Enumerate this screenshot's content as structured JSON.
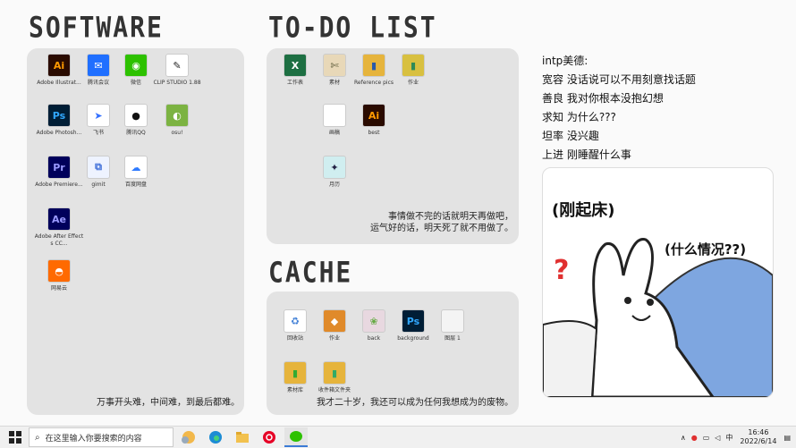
{
  "headings": {
    "software": "SOFTWARE",
    "todo": "TO-DO LIST",
    "cache": "CACHE"
  },
  "software": {
    "icons": [
      {
        "label": "Adobe Illustrat...",
        "glyph": "Ai",
        "bg": "#2a0b00",
        "fg": "#ff9a00"
      },
      {
        "label": "腾讯会议",
        "glyph": "✉",
        "bg": "#1f6fff",
        "fg": "#ffffff"
      },
      {
        "label": "微信",
        "glyph": "◉",
        "bg": "#2dc100",
        "fg": "#ffffff"
      },
      {
        "label": "CLIP STUDIO 1.88",
        "glyph": "✎",
        "bg": "#ffffff",
        "fg": "#222222"
      },
      {
        "label": "Adobe Photosh...",
        "glyph": "Ps",
        "bg": "#001e36",
        "fg": "#31a8ff"
      },
      {
        "label": "飞书",
        "glyph": "➤",
        "bg": "#ffffff",
        "fg": "#3370ff"
      },
      {
        "label": "腾讯QQ",
        "glyph": "●",
        "bg": "#ffffff",
        "fg": "#111111"
      },
      {
        "label": "osu!",
        "glyph": "◐",
        "bg": "#7cb342",
        "fg": "#ffffff"
      },
      {
        "label": "Adobe Premiere...",
        "glyph": "Pr",
        "bg": "#00005b",
        "fg": "#9999ff"
      },
      {
        "label": "gimit",
        "glyph": "⧉",
        "bg": "#eef3ff",
        "fg": "#3f6ed8"
      },
      {
        "label": "百度网盘",
        "glyph": "☁",
        "bg": "#ffffff",
        "fg": "#2f7bff"
      },
      {
        "label": "Adobe After Effects CC...",
        "glyph": "Ae",
        "bg": "#00005b",
        "fg": "#9999ff"
      },
      {
        "label": "网易云",
        "glyph": "◓",
        "bg": "#ff6a00",
        "fg": "#ffffff"
      }
    ],
    "caption": "万事开头难，中间难，到最后都难。"
  },
  "todo": {
    "icons": [
      {
        "label": "工作表",
        "glyph": "X",
        "bg": "#1d6f42",
        "fg": "#ffffff"
      },
      {
        "label": "素材",
        "glyph": "✄",
        "bg": "#e8d8b8",
        "fg": "#553"
      },
      {
        "label": "Reference pics",
        "glyph": "▮",
        "bg": "#e6b43c",
        "fg": "#2a5aa8"
      },
      {
        "label": "作业",
        "glyph": "▮",
        "bg": "#d8c040",
        "fg": "#2e8b57"
      },
      {
        "label": "画稿",
        "glyph": "",
        "bg": "#ffffff",
        "fg": "#999"
      },
      {
        "label": "best",
        "glyph": "Ai",
        "bg": "#2a0b00",
        "fg": "#ff9a00"
      },
      {
        "label": "月历",
        "glyph": "✦",
        "bg": "#d0eef0",
        "fg": "#224"
      }
    ],
    "caption_line1": "事情做不完的话就明天再做吧，",
    "caption_line2": "运气好的话，明天死了就不用做了。"
  },
  "cache": {
    "icons": [
      {
        "label": "回收站",
        "glyph": "♻",
        "bg": "#ffffff",
        "fg": "#3a7bd5"
      },
      {
        "label": "作业",
        "glyph": "◆",
        "bg": "#e08a2a",
        "fg": "#fff"
      },
      {
        "label": "back",
        "glyph": "❀",
        "bg": "#e8d8e0",
        "fg": "#6a4"
      },
      {
        "label": "background",
        "glyph": "Ps",
        "bg": "#001e36",
        "fg": "#31a8ff"
      },
      {
        "label": "图层 1",
        "glyph": "",
        "bg": "#f4f4f4",
        "fg": "#999"
      },
      {
        "label": "素材库",
        "glyph": "▮",
        "bg": "#e6b43c",
        "fg": "#3a3"
      },
      {
        "label": "收件箱文件夹",
        "glyph": "▮",
        "bg": "#e6b43c",
        "fg": "#3a6"
      }
    ],
    "caption": "我才二十岁，我还可以成为任何我想成为的废物。"
  },
  "notes": {
    "title": "intp美德:",
    "lines": [
      "宽容 没话说可以不用刻意找话题",
      "善良 我对你根本没抱幻想",
      "求知 为什么???",
      "坦率 没兴趣",
      "上进 刚睡醒什么事"
    ]
  },
  "meme": {
    "bubble1": "刚起床",
    "bubble2": "什么情况??",
    "question": "?"
  },
  "taskbar": {
    "search_placeholder": "在这里输入你要搜索的内容",
    "time": "16:46",
    "date": "2022/6/14",
    "ime": "中",
    "apps": [
      "weather",
      "edge",
      "explorer",
      "netease-music",
      "wechat"
    ]
  }
}
